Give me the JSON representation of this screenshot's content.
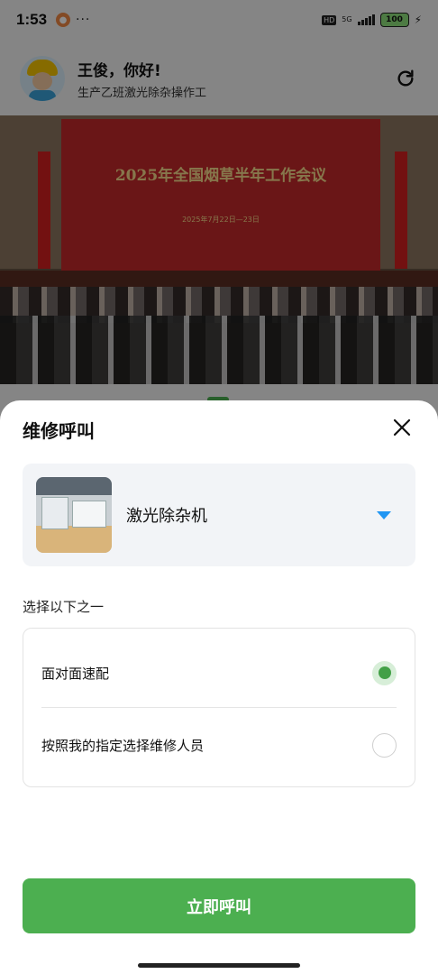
{
  "status_bar": {
    "time": "1:53",
    "dots": "···",
    "hd": "HD",
    "network": "5G",
    "battery": "100"
  },
  "header": {
    "name": "王俊，你好!",
    "role": "生产乙班激光除杂操作工"
  },
  "banner": {
    "title": "2025年全国烟草半年工作会议",
    "date": "2025年7月22日—23日"
  },
  "sheet": {
    "title": "维修呼叫",
    "machine_name": "激光除杂机",
    "choose_label": "选择以下之一",
    "options": [
      {
        "label": "面对面速配",
        "selected": true
      },
      {
        "label": "按照我的指定选择维修人员",
        "selected": false
      }
    ],
    "call_button": "立即呼叫"
  },
  "colors": {
    "accent_green": "#4caf50",
    "dropdown_blue": "#2196f3"
  },
  "icons": {
    "refresh": "refresh-icon",
    "close": "close-icon",
    "dropdown": "caret-down-icon"
  }
}
